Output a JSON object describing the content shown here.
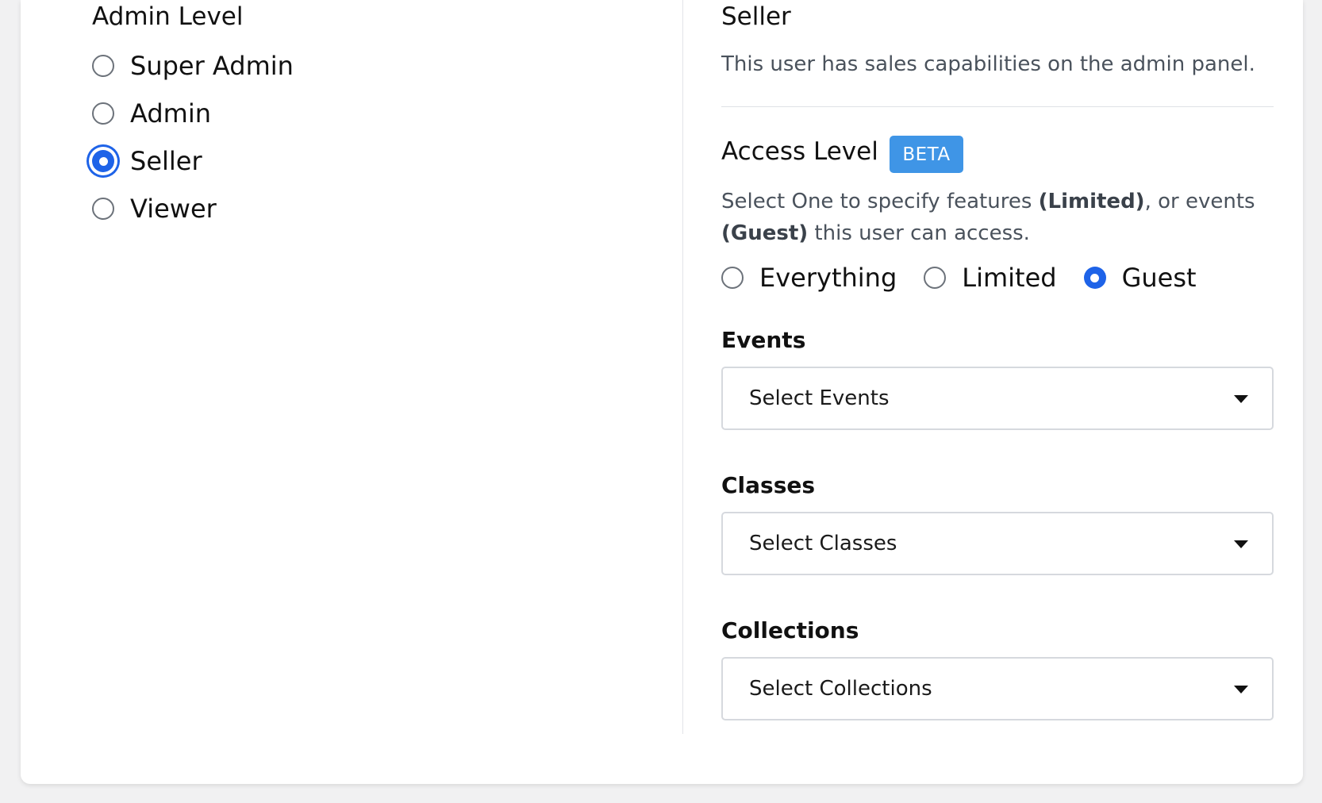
{
  "admin_level": {
    "heading": "Admin Level",
    "options": [
      {
        "label": "Super Admin",
        "checked": false
      },
      {
        "label": "Admin",
        "checked": false
      },
      {
        "label": "Seller",
        "checked": true
      },
      {
        "label": "Viewer",
        "checked": false
      }
    ]
  },
  "role_info": {
    "title": "Seller",
    "description": "This user has sales capabilities on the admin panel."
  },
  "access_level": {
    "heading": "Access Level",
    "badge": "BETA",
    "desc_part1": "Select One to specify features ",
    "desc_limited": "(Limited)",
    "desc_part2": ", or events ",
    "desc_guest": "(Guest)",
    "desc_part3": " this user can access.",
    "options": [
      {
        "label": "Everything",
        "checked": false
      },
      {
        "label": "Limited",
        "checked": false
      },
      {
        "label": "Guest",
        "checked": true
      }
    ]
  },
  "fields": {
    "events": {
      "label": "Events",
      "placeholder": "Select Events"
    },
    "classes": {
      "label": "Classes",
      "placeholder": "Select Classes"
    },
    "collections": {
      "label": "Collections",
      "placeholder": "Select Collections"
    }
  },
  "colors": {
    "accent": "#1e63e8",
    "badge": "#3f95e6"
  }
}
